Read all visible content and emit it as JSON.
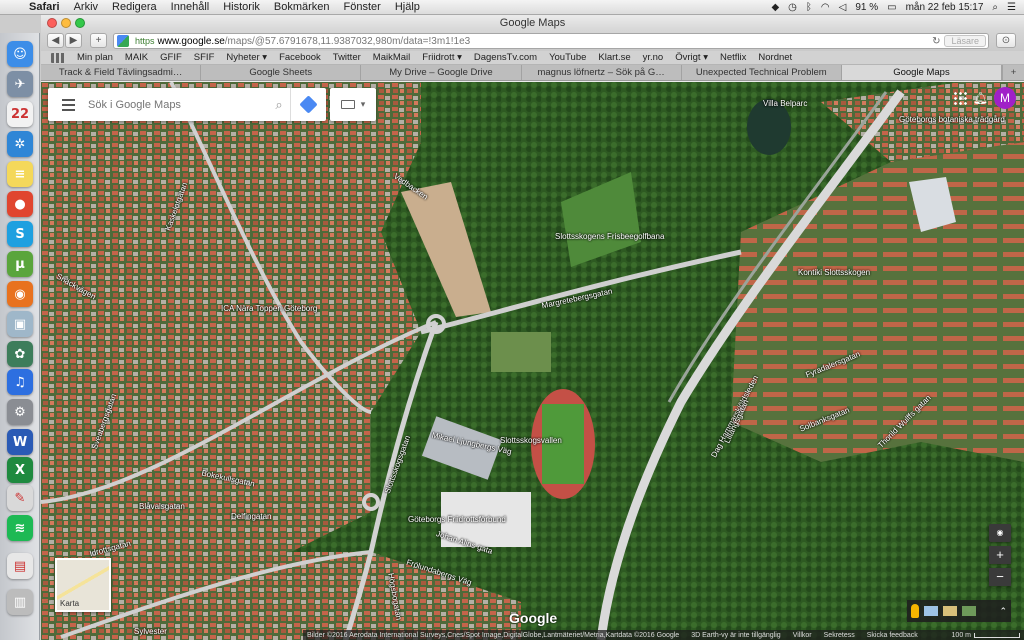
{
  "menubar": {
    "app_name": "Safari",
    "items": [
      "Arkiv",
      "Redigera",
      "Innehåll",
      "Historik",
      "Bokmärken",
      "Fönster",
      "Hjälp"
    ],
    "battery": "91 %",
    "datetime": "mån 22 feb  15:17"
  },
  "dock": {
    "icons": [
      {
        "name": "finder-icon",
        "glyph": "☺",
        "color": "#3c8de8"
      },
      {
        "name": "launchpad-icon",
        "glyph": "✈",
        "color": "#7d8fa5"
      },
      {
        "name": "calendar-icon",
        "glyph": "22",
        "color": "#f2f2f2"
      },
      {
        "name": "safari-icon",
        "glyph": "✲",
        "color": "#2f86d6"
      },
      {
        "name": "notes-icon",
        "glyph": "≡",
        "color": "#f4d85a"
      },
      {
        "name": "chrome-icon",
        "glyph": "●",
        "color": "#e0452f"
      },
      {
        "name": "skype-icon",
        "glyph": "S",
        "color": "#1ea0e0"
      },
      {
        "name": "utorrent-icon",
        "glyph": "µ",
        "color": "#5aa53c"
      },
      {
        "name": "firefox-icon",
        "glyph": "◉",
        "color": "#e8721f"
      },
      {
        "name": "preview-icon",
        "glyph": "▣",
        "color": "#9fb7c9"
      },
      {
        "name": "photos-icon",
        "glyph": "✿",
        "color": "#3d7d5b"
      },
      {
        "name": "itunes-icon",
        "glyph": "♫",
        "color": "#2d6fe0"
      },
      {
        "name": "system-preferences-icon",
        "glyph": "⚙",
        "color": "#8a8d93"
      },
      {
        "name": "word-icon",
        "glyph": "W",
        "color": "#2a5ab5"
      },
      {
        "name": "excel-icon",
        "glyph": "X",
        "color": "#1f8a3f"
      },
      {
        "name": "textedit-icon",
        "glyph": "✎",
        "color": "#d9d9d9"
      },
      {
        "name": "spotify-icon",
        "glyph": "≋",
        "color": "#1db954"
      },
      {
        "name": "documents-icon",
        "glyph": "▤",
        "color": "#e7e7e7"
      },
      {
        "name": "trash-icon",
        "glyph": "▥",
        "color": "#bcbcbc"
      }
    ]
  },
  "window": {
    "title": "Google Maps",
    "url_secure": "https",
    "url_domain": "www.google.se",
    "url_path": "/maps/@57.6791678,11.9387032,980m/data=!3m1!1e3",
    "reader_label": "Läsare"
  },
  "bookmarks": [
    "Min plan",
    "MAIK",
    "GFIF",
    "SFIF",
    "Nyheter ▾",
    "Facebook",
    "Twitter",
    "MaikMail",
    "Friidrott ▾",
    "DagensTv.com",
    "YouTube",
    "Klart.se",
    "yr.no",
    "Övrigt ▾",
    "Netflix",
    "Nordnet"
  ],
  "tabs": [
    {
      "label": "Track & Field Tävlingsadmi…",
      "active": false
    },
    {
      "label": "Google Sheets",
      "active": false
    },
    {
      "label": "My Drive – Google Drive",
      "active": false
    },
    {
      "label": "magnus löfnertz – Sök på G…",
      "active": false
    },
    {
      "label": "Unexpected Technical Problem",
      "active": false
    },
    {
      "label": "Google Maps",
      "active": true
    }
  ],
  "maps": {
    "search_placeholder": "Sök i Google Maps",
    "avatar_letter": "M",
    "mini_map_label": "Karta",
    "logo": "Google",
    "zoom_in": "+",
    "zoom_out": "−",
    "footer": {
      "imagery": "Bilder ©2016 Aerodata International Surveys,Cnes/Spot Image,DigitalGlobe,Lantmäteriet/Metria,Kartdata ©2016 Google",
      "earth": "3D Earth-vy är inte tillgänglig",
      "terms": "Villkor",
      "privacy": "Sekretess",
      "feedback": "Skicka feedback",
      "scale": "100 m"
    },
    "labels": [
      "Villa Belparc",
      "Göteborgs botaniska trädgård",
      "Vedbacken",
      "Slottsskogens Frisbeegolfbana",
      "Margretebergsgatan",
      "Kontiki Slottsskogen",
      "Snäckvägen",
      "ICA Nära Toppen Göteborg",
      "Slottsskogsvallen",
      "Mikael Ljungbergs Väg",
      "Dag Hammarskjöldsleden",
      "Solbanksgatan",
      "Fyradalersgatan",
      "Thorild Wulffs gatan",
      "Slottsskogsgatan",
      "Bokekullsgatan",
      "Blåvalsgatan",
      "Delfingatan",
      "Göteborgs Friidrottsförbund",
      "Johan Alins gata",
      "Frölundabergs Väg",
      "Idrottsgatan",
      "Högsbogatan",
      "Sveabergsgatan",
      "Kaskelotgatan",
      "Lillängsgatan",
      "Sylvester"
    ]
  }
}
